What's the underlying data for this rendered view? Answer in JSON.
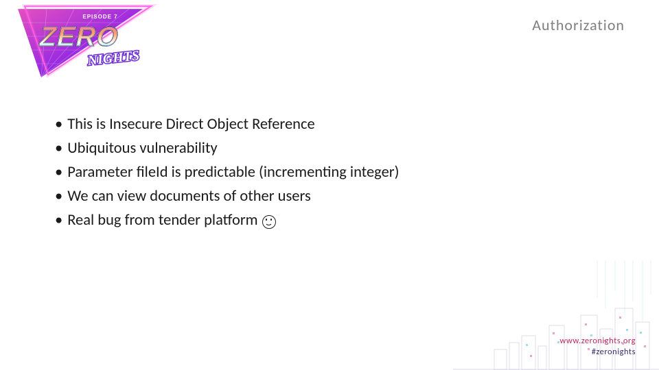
{
  "logo": {
    "episode_label": "EPISODE 7",
    "title_main": "ZERO",
    "title_sub": "NIGHTS"
  },
  "header": {
    "title": "Authorization"
  },
  "bullets": [
    "This is Insecure Direct Object Reference",
    "Ubiquitous vulnerability",
    "Parameter fileId is predictable (incrementing integer)",
    "We can view documents of other users",
    "Real bug from tender platform"
  ],
  "bullet_has_smiley": [
    false,
    false,
    false,
    false,
    true
  ],
  "footer": {
    "url": "www.zeronights.org",
    "hashtag": "#zeronights"
  },
  "colors": {
    "title": "#808080",
    "text": "#1a1a1a",
    "brand_pink": "#b92b5f",
    "brand_purple": "#3a2d6a",
    "logo_magenta": "#cc2a9b",
    "logo_purple": "#7a2bd6",
    "logo_cyan": "#1fb6d0"
  }
}
